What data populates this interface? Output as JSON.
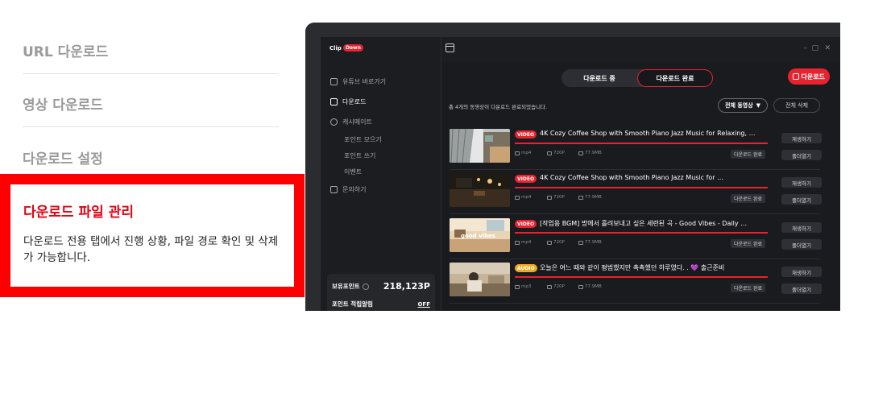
{
  "feature_menu": {
    "items": [
      {
        "label": "URL 다운로드"
      },
      {
        "label": "영상 다운로드"
      },
      {
        "label": "다운로드 설정"
      }
    ],
    "active": {
      "title": "다운로드 파일 관리",
      "description": "다운로드 전용 탭에서 진행 상황, 파일 경로 확인 및 삭제가 가능합니다."
    }
  },
  "app": {
    "logo": {
      "text": "Clip",
      "pill": "Down"
    },
    "window_controls": [
      "–",
      "▢",
      "✕"
    ],
    "sidebar": {
      "nav": [
        {
          "label": "유튜브 바로가기",
          "icon": "home-icon"
        },
        {
          "label": "다운로드",
          "icon": "download-icon"
        },
        {
          "label": "캐시메이트",
          "icon": "coin-icon"
        }
      ],
      "sub_items": [
        "포인트 모으기",
        "포인트 쓰기",
        "이벤트"
      ],
      "contact": {
        "label": "문의하기",
        "icon": "chat-icon"
      },
      "points": {
        "label": "보유포인트",
        "value": "218,123P",
        "alert_label": "포인트 적립알림",
        "alert_value": "OFF"
      }
    },
    "tabs": {
      "downloading": "다운로드 중",
      "completed": "다운로드 완료"
    },
    "download_button": "다운로드",
    "summary": "총 4개의 동영상이 다운로드 완료되었습니다.",
    "filter": {
      "selected": "전체 동영상",
      "arrow": "▼"
    },
    "delete_all": "전체 삭제",
    "items": [
      {
        "badge": "VIDEO",
        "title": "4K Cozy Coffee Shop with Smooth Piano Jazz Music for Relaxing, …",
        "format": "mp4",
        "quality": "720P",
        "size": "77.9MB",
        "status": "다운로드 완료",
        "play": "재생하기",
        "open": "폴더열기"
      },
      {
        "badge": "VIDEO",
        "title": "4K Cozy Coffee Shop with Smooth Piano Jazz Music for …",
        "format": "mp4",
        "quality": "720P",
        "size": "77.9MB",
        "status": "다운로드 완료",
        "play": "재생하기",
        "open": "폴더열기"
      },
      {
        "badge": "VIDEO",
        "title": "[작업용 BGM] 방에서 흘려보내고 싶은 세련된 곡 - Good Vibes - Daily …",
        "format": "mp4",
        "quality": "720P",
        "size": "77.9MB",
        "status": "다운로드 완료",
        "play": "재생하기",
        "open": "폴더열기"
      },
      {
        "badge": "AUDIO",
        "title": "오늘은 여느 때와 같이 평범했지만 촉촉했던 하루였다. . 💜 출근준비",
        "format": "mp3",
        "quality": "720P",
        "size": "77.9MB",
        "status": "다운로드 완료",
        "play": "재생하기",
        "open": "폴더열기"
      }
    ]
  },
  "colors": {
    "accent": "#e8232f",
    "highlight_border": "#ff0000",
    "active_text": "#e60012",
    "audio_badge": "#f0a91b"
  }
}
